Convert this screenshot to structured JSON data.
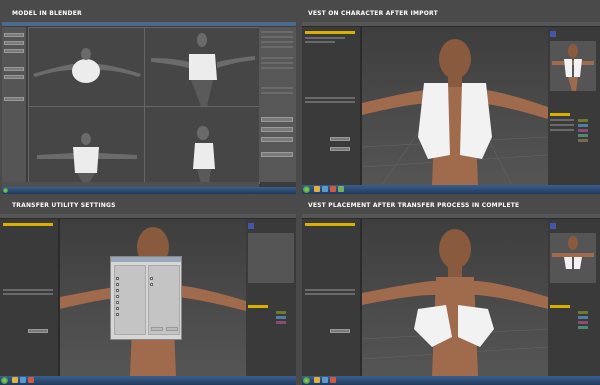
{
  "captions": {
    "top_left": "MODEL IN BLENDER",
    "top_right": "VEST ON CHARACTER AFTER IMPORT",
    "bottom_left": "TRANSFER UTILITY SETTINGS",
    "bottom_right": "VEST PLACEMENT AFTER TRANSFER PROCESS IN COMPLETE"
  },
  "colors": {
    "caption_text": "#ffffff",
    "page_bg": "#4a4a4a",
    "blender_accent": "#3a6fb0",
    "daz_tab_accent": "#d9b000",
    "vest": "#f2f2f2",
    "skin": "#a06a4c"
  },
  "icons": [
    "windows-start-icon",
    "taskbar-app-icon",
    "camera-cube-icon"
  ]
}
